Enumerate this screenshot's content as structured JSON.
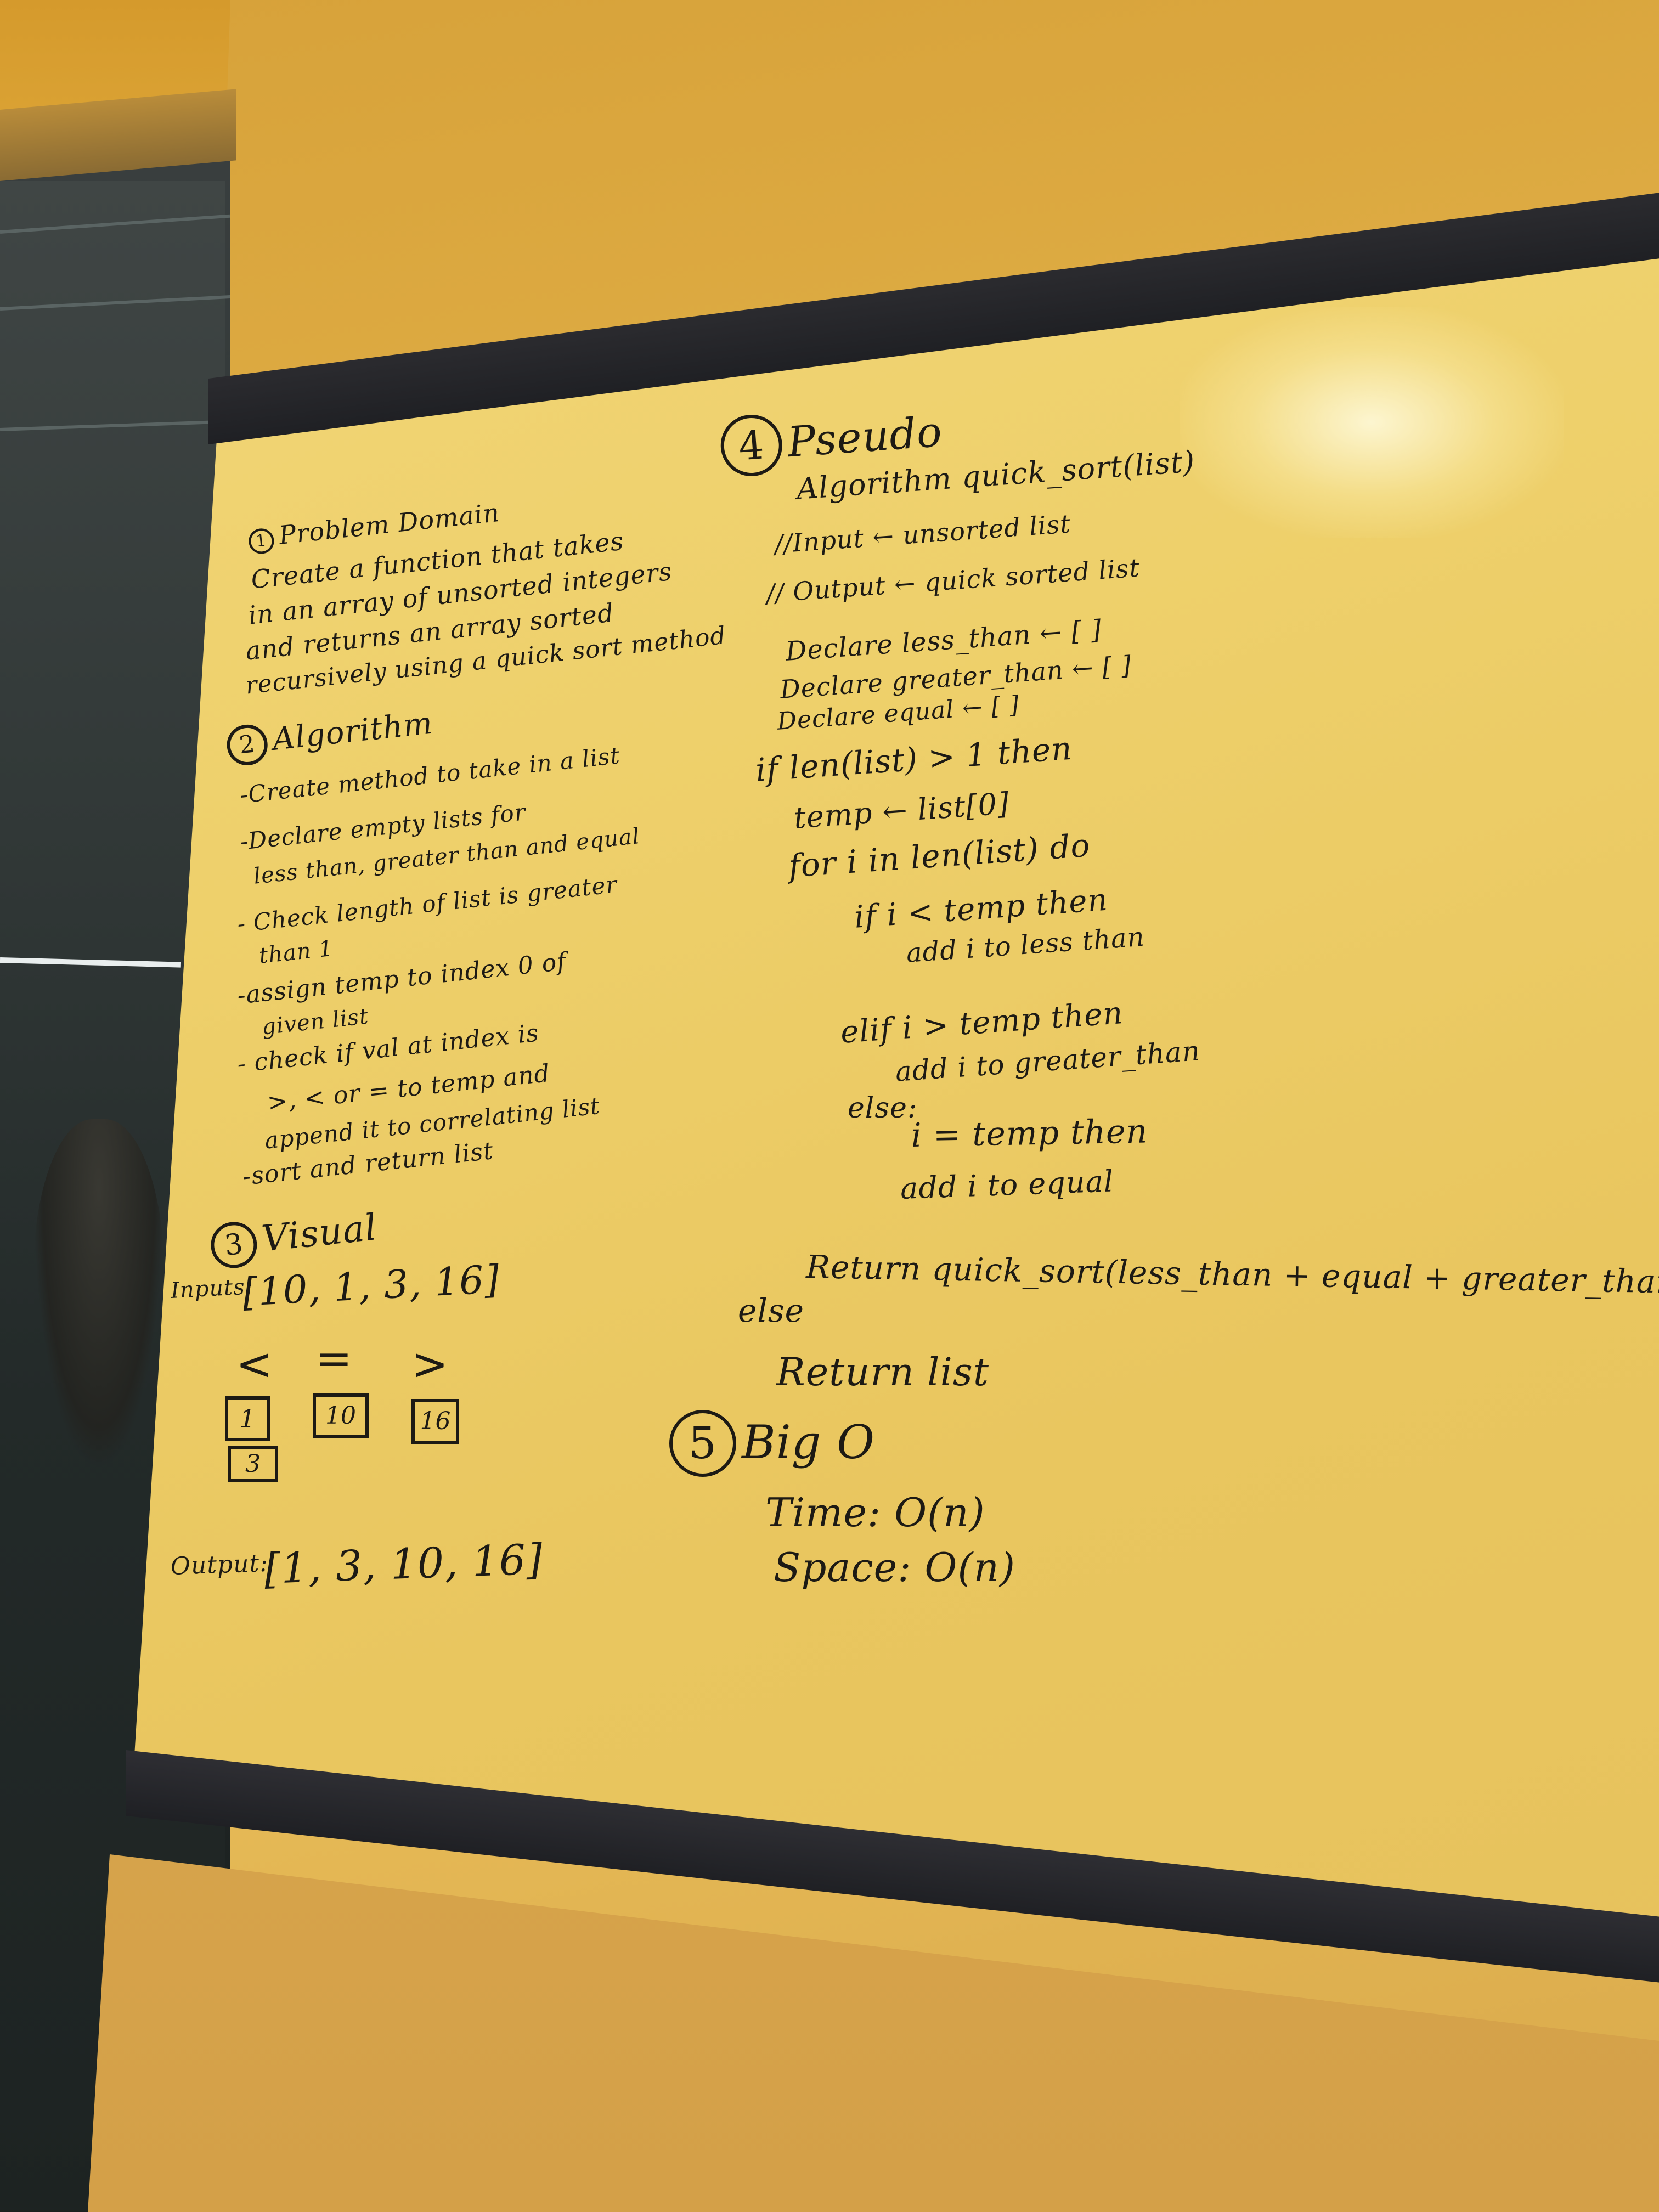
{
  "section1": {
    "number": "1",
    "title": "Problem Domain",
    "lines": [
      "Create a function that takes",
      "in an array of unsorted integers",
      "and returns an array sorted",
      "recursively using a quick sort method"
    ]
  },
  "section2": {
    "number": "2",
    "title": "Algorithm",
    "lines": [
      "-Create method to take in a list",
      "-Declare empty lists for",
      "less than, greater than and equal",
      "- Check length of list is greater",
      "than 1",
      "-assign temp to index 0 of",
      "given list",
      "- check if val at index is",
      ">, < or = to temp and",
      "append it to correlating list",
      "-sort and return list"
    ]
  },
  "section3": {
    "number": "3",
    "title": "Visual",
    "input_label": "Inputs:",
    "input_value": "[10, 1, 3, 16]",
    "less_symbol": "<",
    "equal_symbol": "=",
    "greater_symbol": ">",
    "less_items": [
      "1",
      "3"
    ],
    "equal_items": [
      "10"
    ],
    "greater_items": [
      "16"
    ],
    "output_label": "Output:",
    "output_value": "[1, 3, 10, 16]"
  },
  "section4": {
    "number": "4",
    "title": "Pseudo",
    "lines": [
      "Algorithm quick_sort(list)",
      "//Input ← unsorted list",
      "// Output ← quick sorted list",
      "Declare less_than ← [ ]",
      "Declare greater_than ← [ ]",
      "Declare equal ← [ ]",
      "if len(list) > 1 then",
      "temp ← list[0]",
      "for i in len(list) do",
      "if i < temp then",
      "add i to less than",
      "elif i > temp then",
      "add i to greater_than",
      "else:",
      "i = temp then",
      "add i to equal",
      "Return quick_sort(less_than + equal + greater_than)",
      "else",
      "Return list"
    ]
  },
  "section5": {
    "number": "5",
    "title": "Big O",
    "time": "Time: O(n)",
    "space": "Space: O(n)"
  }
}
